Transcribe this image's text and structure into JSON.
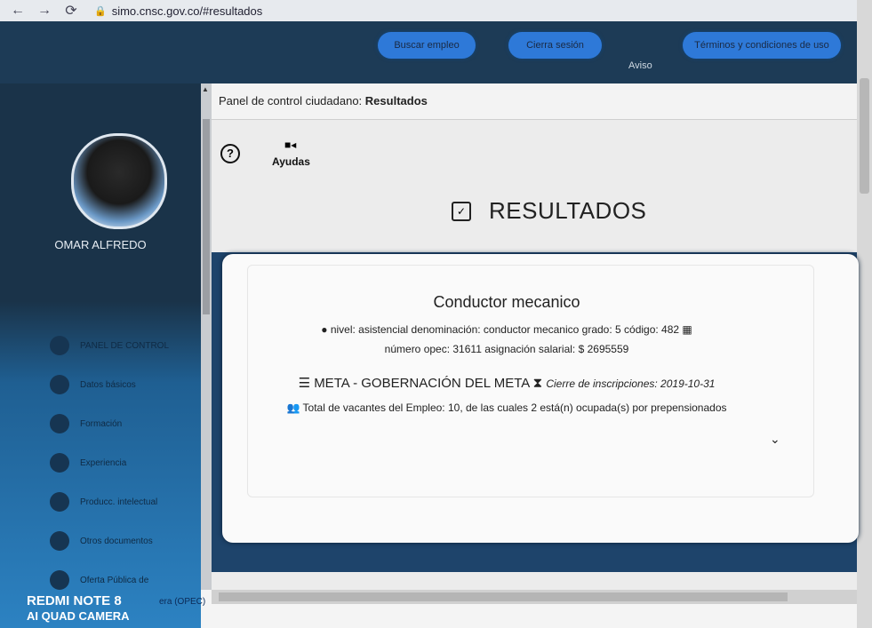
{
  "browser": {
    "url": "simo.cnsc.gov.co/#resultados"
  },
  "topnav": {
    "buscar": "Buscar empleo",
    "cierra": "Cierra sesión",
    "aviso": "Aviso",
    "terminos": "Términos y condiciones de uso"
  },
  "sidebar": {
    "user": "OMAR ALFREDO",
    "items": [
      {
        "label": "PANEL DE CONTROL"
      },
      {
        "label": "Datos básicos"
      },
      {
        "label": "Formación"
      },
      {
        "label": "Experiencia"
      },
      {
        "label": "Producc. intelectual"
      },
      {
        "label": "Otros documentos"
      },
      {
        "label": "Oferta Pública de"
      }
    ],
    "opec_partial": "era (OPEC)"
  },
  "panel": {
    "prefix": "Panel de control ciudadano: ",
    "title": "Resultados"
  },
  "help": {
    "ayudas": "Ayudas"
  },
  "results": {
    "title": "RESULTADOS",
    "job": {
      "name": "Conductor mecanico",
      "line1": "nivel: asistencial  denominación: conductor mecanico  grado: 5  código: 482",
      "line2": "número opec: 31611  asignación salarial: $ 2695559",
      "entity": "META - GOBERNACIÓN DEL META",
      "cierre": "Cierre de inscripciones: 2019-10-31",
      "vacantes": "Total de vacantes del Empleo: 10, de las cuales 2 está(n) ocupada(s) por prepensionados"
    }
  },
  "watermark": {
    "line1": "REDMI NOTE 8",
    "line2": "AI QUAD CAMERA"
  }
}
